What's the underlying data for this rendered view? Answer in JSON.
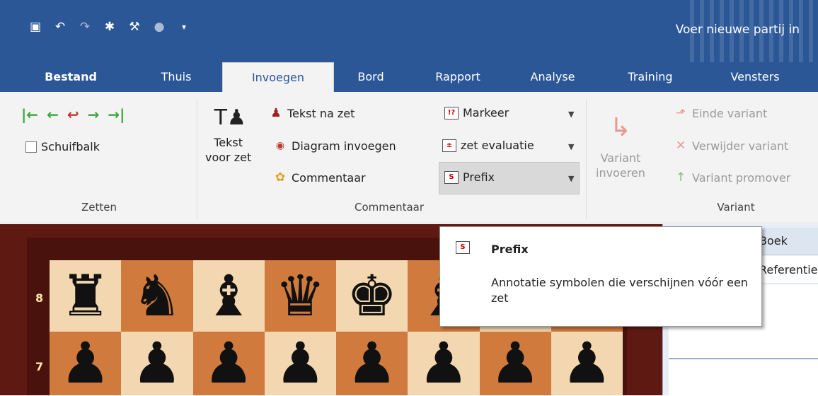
{
  "window": {
    "title": "Voer nieuwe partij in"
  },
  "qat": {
    "icons": [
      "save-icon",
      "undo-icon",
      "redo-icon",
      "engine-icon",
      "tools-icon",
      "bulb-icon",
      "customize-icon"
    ]
  },
  "tabs": [
    {
      "label": "Bestand"
    },
    {
      "label": "Thuis"
    },
    {
      "label": "Invoegen"
    },
    {
      "label": "Bord"
    },
    {
      "label": "Rapport"
    },
    {
      "label": "Analyse"
    },
    {
      "label": "Training"
    },
    {
      "label": "Vensters"
    }
  ],
  "ribbon": {
    "zetten": {
      "scrollbar_label": "Schuifbalk",
      "group_label": "Zetten"
    },
    "commentaar": {
      "text_before_move": "Tekst voor zet",
      "text_before_move_line1": "Tekst",
      "text_before_move_line2": "voor zet",
      "text_after_move": "Tekst na zet",
      "insert_diagram": "Diagram invoegen",
      "comment": "Commentaar",
      "mark": "Markeer",
      "move_eval": "zet evaluatie",
      "prefix": "Prefix",
      "group_label": "Commentaar"
    },
    "variant": {
      "insert_line1": "Variant",
      "insert_line2": "invoeren",
      "end_variant": "Einde variant",
      "delete_variant": "Verwijder variant",
      "promote_variant": "Variant promover",
      "group_label": "Variant"
    }
  },
  "board": {
    "ranks": [
      "8",
      "7"
    ],
    "row8": [
      "♜",
      "♞",
      "♝",
      "♛",
      "♚",
      "♝",
      "♞",
      "♜"
    ],
    "row7": [
      "♟",
      "♟",
      "♟",
      "♟",
      "♟",
      "♟",
      "♟",
      "♟"
    ]
  },
  "panel": {
    "head": "Boek",
    "tab": "Referentie"
  },
  "tooltip": {
    "title": "Prefix",
    "description": "Annotatie symbolen die verschijnen vóór een zet"
  },
  "colors": {
    "accent": "#2b5797",
    "ribbon_bg": "#f3f3f3",
    "board_dark": "#d07a3e",
    "board_light": "#f2d7b0"
  }
}
